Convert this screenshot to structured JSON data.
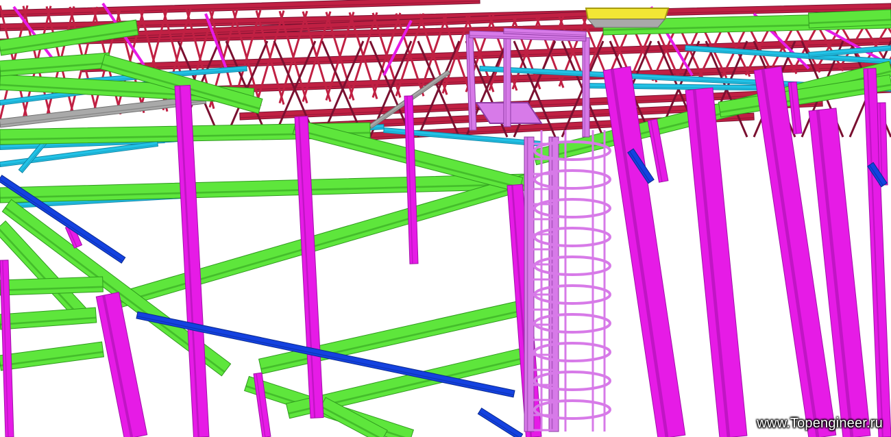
{
  "watermark": "www.Topengineer.ru",
  "colors": {
    "background": "#ffffff",
    "columns": "#e61be6",
    "columns_dark": "#a010a8",
    "main_beams": "#5ee63c",
    "main_beams_dark": "#2f9a1e",
    "secondary_beams": "#22c2e6",
    "roof_trusses": "#c02043",
    "roof_trusses_dark": "#7a1030",
    "bracing": "#1442e0",
    "ladder": "#d77ae8",
    "roof_hatch": "#f2e635",
    "grey_member": "#a9a9a9"
  }
}
